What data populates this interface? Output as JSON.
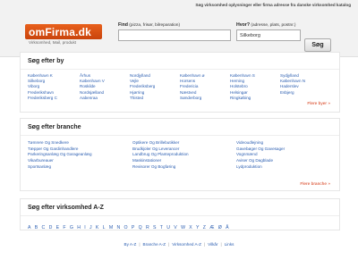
{
  "topbar": {
    "tagline": "Søg virksomhed oplysninger eller firma adresse fra danske virksomhed katalog"
  },
  "logo": {
    "name": "omFirma.dk",
    "tagline": "Virksomhed, Mail, produkt"
  },
  "search": {
    "what_label": "Find",
    "what_hint": "(pizza, frisør, bilreparation)",
    "what_value": "",
    "where_label": "Hvor?",
    "where_hint": "(adresse, plats, postnr.)",
    "where_value": "Silkeborg",
    "button_label": "Søg"
  },
  "cities": {
    "title": "Søg efter by",
    "more_label": "Flere byer »",
    "columns": [
      [
        "København K",
        "Silkeborg",
        "Viborg",
        "Frederikshavn",
        "Frederiksberg C"
      ],
      [
        "Århus",
        "København V",
        "Roskilde",
        "Nordsjælland",
        "Aabenraa"
      ],
      [
        "Nordjylland",
        "Vejle",
        "Frederiksberg",
        "Hjørring",
        "Thisted"
      ],
      [
        "København ø",
        "Horsens",
        "Fredericia",
        "Næstved",
        "Sønderborg"
      ],
      [
        "København S",
        "Herning",
        "Holstebro",
        "Helsingør",
        "Ringkøbing"
      ],
      [
        "Sydjylland",
        "København N",
        "Haderslev",
        "Esbjerg"
      ]
    ]
  },
  "branches": {
    "title": "Søg efter branche",
    "more_label": "Flere branche »",
    "columns": [
      [
        "Tømrere Og Snedkere",
        "Tæpper Og Gardinhandlere",
        "Parkeringsanlæg Og Garageanlæg",
        "Vikarbureauer",
        "Sportsanlæg"
      ],
      [
        "Optikere Og Brillebutikker",
        "Brudkjoler Og Leverancer",
        "Landbrug Og Planteproduktion",
        "Maskinstationer",
        "Revisorer Og Bogføring"
      ],
      [
        "Videoudlejning",
        "Gavebøger Og Gavesager",
        "Vognmænd",
        "Aviser Og Dagblade",
        "Lydproduktion"
      ]
    ]
  },
  "az": {
    "title": "Søg efter virksomhed A-Z",
    "letters": [
      "A",
      "B",
      "C",
      "D",
      "E",
      "F",
      "G",
      "H",
      "I",
      "J",
      "K",
      "L",
      "M",
      "N",
      "O",
      "P",
      "Q",
      "R",
      "S",
      "T",
      "U",
      "V",
      "W",
      "X",
      "Y",
      "Z",
      "Æ",
      "Ø",
      "Å"
    ]
  },
  "footer": {
    "links": [
      "By A-Z",
      "Branche A-Z",
      "Virksomhed A-Z",
      "Vilkår",
      "Links"
    ]
  },
  "colors": {
    "link": "#2a5db0",
    "more": "#d4330d",
    "logo": "#e8601c"
  }
}
